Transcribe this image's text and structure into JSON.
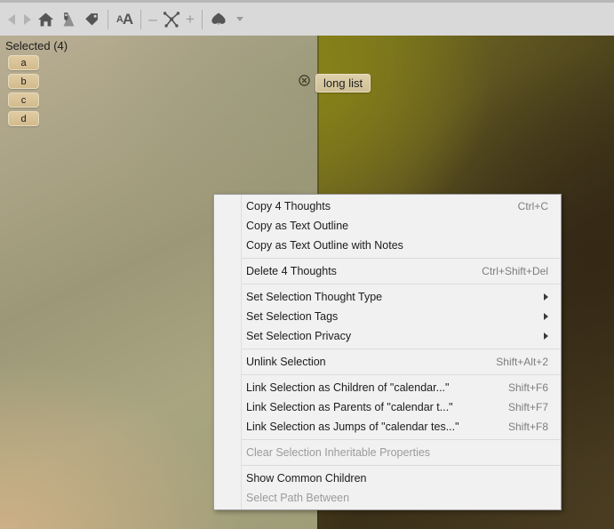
{
  "toolbar": {
    "items": [
      {
        "name": "back-arrow-icon",
        "kind": "arrow-left",
        "label": "Back"
      },
      {
        "name": "forward-arrow-icon",
        "kind": "arrow-right",
        "label": "Forward"
      },
      {
        "name": "home-icon",
        "kind": "home",
        "label": "Home"
      },
      {
        "name": "pin-map-icon",
        "kind": "pin",
        "label": "Pins"
      },
      {
        "name": "tag-icon",
        "kind": "tag",
        "label": "Tags"
      },
      {
        "name": "font-size-icon",
        "kind": "aa",
        "label": "aA"
      },
      {
        "name": "zoom-out-icon",
        "kind": "minus",
        "label": "–"
      },
      {
        "name": "thought-graph-icon",
        "kind": "graph",
        "label": "Graph"
      },
      {
        "name": "zoom-in-icon",
        "kind": "plus",
        "label": "+"
      },
      {
        "name": "brain-cloud-icon",
        "kind": "cloud",
        "label": "Brain"
      },
      {
        "name": "dropdown-caret-icon",
        "kind": "caret",
        "label": "More"
      }
    ]
  },
  "selection": {
    "title": "Selected (4)",
    "items": [
      {
        "label": "a"
      },
      {
        "label": "b"
      },
      {
        "label": "c"
      },
      {
        "label": "d"
      }
    ]
  },
  "tabs": {
    "close_icon": "close-circle-icon",
    "active": {
      "label": "long list"
    }
  },
  "context_menu": {
    "groups": [
      {
        "items": [
          {
            "label": "Copy 4 Thoughts",
            "shortcut": "Ctrl+C",
            "submenu": false,
            "disabled": false
          },
          {
            "label": "Copy as Text Outline",
            "shortcut": "",
            "submenu": false,
            "disabled": false
          },
          {
            "label": "Copy as Text Outline with Notes",
            "shortcut": "",
            "submenu": false,
            "disabled": false
          }
        ]
      },
      {
        "items": [
          {
            "label": "Delete 4 Thoughts",
            "shortcut": "Ctrl+Shift+Del",
            "submenu": false,
            "disabled": false
          }
        ]
      },
      {
        "items": [
          {
            "label": "Set Selection Thought Type",
            "shortcut": "",
            "submenu": true,
            "disabled": false
          },
          {
            "label": "Set Selection Tags",
            "shortcut": "",
            "submenu": true,
            "disabled": false
          },
          {
            "label": "Set Selection Privacy",
            "shortcut": "",
            "submenu": true,
            "disabled": false
          }
        ]
      },
      {
        "items": [
          {
            "label": "Unlink Selection",
            "shortcut": "Shift+Alt+2",
            "submenu": false,
            "disabled": false
          }
        ]
      },
      {
        "items": [
          {
            "label": "Link Selection as Children of \"calendar...\"",
            "shortcut": "Shift+F6",
            "submenu": false,
            "disabled": false
          },
          {
            "label": "Link Selection as Parents of \"calendar t...\"",
            "shortcut": "Shift+F7",
            "submenu": false,
            "disabled": false
          },
          {
            "label": "Link Selection as Jumps of \"calendar tes...\"",
            "shortcut": "Shift+F8",
            "submenu": false,
            "disabled": false
          }
        ]
      },
      {
        "items": [
          {
            "label": "Clear Selection Inheritable Properties",
            "shortcut": "",
            "submenu": false,
            "disabled": true
          }
        ]
      },
      {
        "items": [
          {
            "label": "Show Common Children",
            "shortcut": "",
            "submenu": false,
            "disabled": false
          },
          {
            "label": "Select Path Between",
            "shortcut": "",
            "submenu": false,
            "disabled": true
          }
        ]
      }
    ]
  },
  "colors": {
    "toolbar_bg": "#d9d9d9",
    "menu_bg": "#f1f1f1",
    "menu_text": "#1b1b1b",
    "menu_disabled": "#9b9b9b",
    "shortcut_text": "#7d7d7d",
    "thought_chip": "#d2bb8c",
    "tab_chip": "#cfc096"
  }
}
